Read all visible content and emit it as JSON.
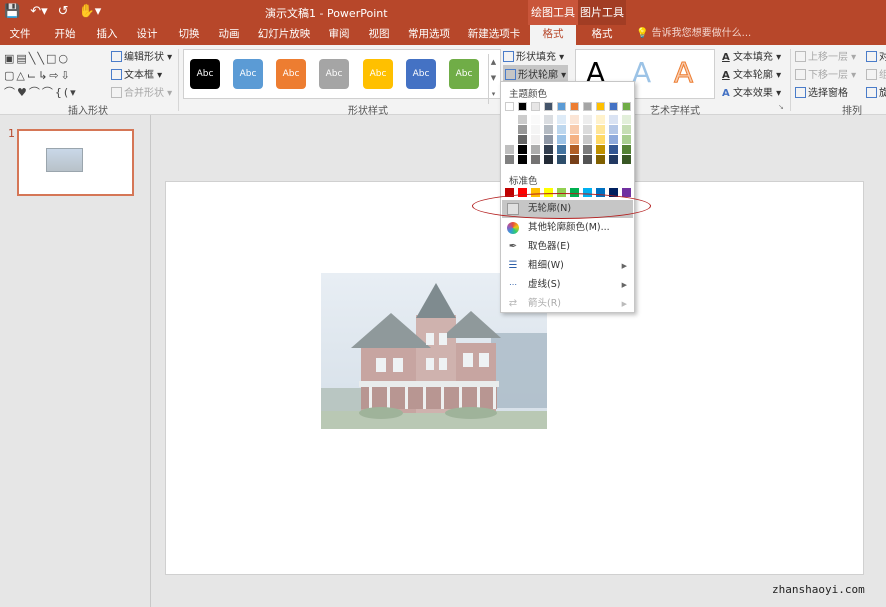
{
  "title_bar": {
    "title": "演示文稿1 - PowerPoint",
    "context_tabs": [
      "绘图工具",
      "图片工具"
    ],
    "qat_icons": [
      "save-icon",
      "undo-icon",
      "redo-icon",
      "touch-mode-icon"
    ]
  },
  "tabs": [
    {
      "label": "文件"
    },
    {
      "label": "开始"
    },
    {
      "label": "插入"
    },
    {
      "label": "设计"
    },
    {
      "label": "切换"
    },
    {
      "label": "动画"
    },
    {
      "label": "幻灯片放映"
    },
    {
      "label": "审阅"
    },
    {
      "label": "视图"
    },
    {
      "label": "常用选项"
    },
    {
      "label": "新建选项卡"
    },
    {
      "label": "格式"
    },
    {
      "label": "格式"
    }
  ],
  "tell_me": "告诉我您想要做什么...",
  "ribbon": {
    "insert_shapes": {
      "label": "插入形状",
      "edit_shape": "编辑形状",
      "text_box": "文本框",
      "merge_shapes": "合并形状"
    },
    "shape_styles": {
      "label": "形状样式",
      "swatch_text": "Abc",
      "swatches": [
        "#000000",
        "#5b9bd5",
        "#ed7d31",
        "#a5a5a5",
        "#ffc000",
        "#4472c4",
        "#70ad47"
      ],
      "shape_fill": "形状填充",
      "shape_outline": "形状轮廓"
    },
    "wordart": {
      "label": "艺术字样式",
      "letter": "A",
      "text_fill": "文本填充",
      "text_outline": "文本轮廓",
      "text_effects": "文本效果"
    },
    "arrange": {
      "label": "排列",
      "bring_forward": "上移一层",
      "send_backward": "下移一层",
      "selection_pane": "选择窗格",
      "align": "对",
      "group": "组",
      "rotate": "旋"
    }
  },
  "slides": {
    "number": "1"
  },
  "outline_menu": {
    "theme_colors_label": "主题颜色",
    "standard_colors_label": "标准色",
    "theme_first_row": [
      "#ffffff",
      "#000000",
      "#e7e6e6",
      "#44546a",
      "#5b9bd5",
      "#ed7d31",
      "#a5a5a5",
      "#ffc000",
      "#4472c4",
      "#70ad47"
    ],
    "standard_colors": [
      "#c00000",
      "#ff0000",
      "#ffc000",
      "#ffff00",
      "#92d050",
      "#00b050",
      "#00b0f0",
      "#0070c0",
      "#002060",
      "#7030a0"
    ],
    "items": [
      {
        "label": "无轮廓(N)",
        "icon": "no-outline-icon",
        "highlighted": true,
        "submenu": false,
        "disabled": false
      },
      {
        "label": "其他轮廓颜色(M)...",
        "icon": "color-wheel-icon",
        "highlighted": false,
        "submenu": false,
        "disabled": false
      },
      {
        "label": "取色器(E)",
        "icon": "eyedropper-icon",
        "highlighted": false,
        "submenu": false,
        "disabled": false
      },
      {
        "label": "粗细(W)",
        "icon": "line-weight-icon",
        "highlighted": false,
        "submenu": true,
        "disabled": false
      },
      {
        "label": "虚线(S)",
        "icon": "dashes-icon",
        "highlighted": false,
        "submenu": true,
        "disabled": false
      },
      {
        "label": "箭头(R)",
        "icon": "arrows-icon",
        "highlighted": false,
        "submenu": true,
        "disabled": true
      }
    ]
  },
  "watermark": "zhanshaoyi.com"
}
